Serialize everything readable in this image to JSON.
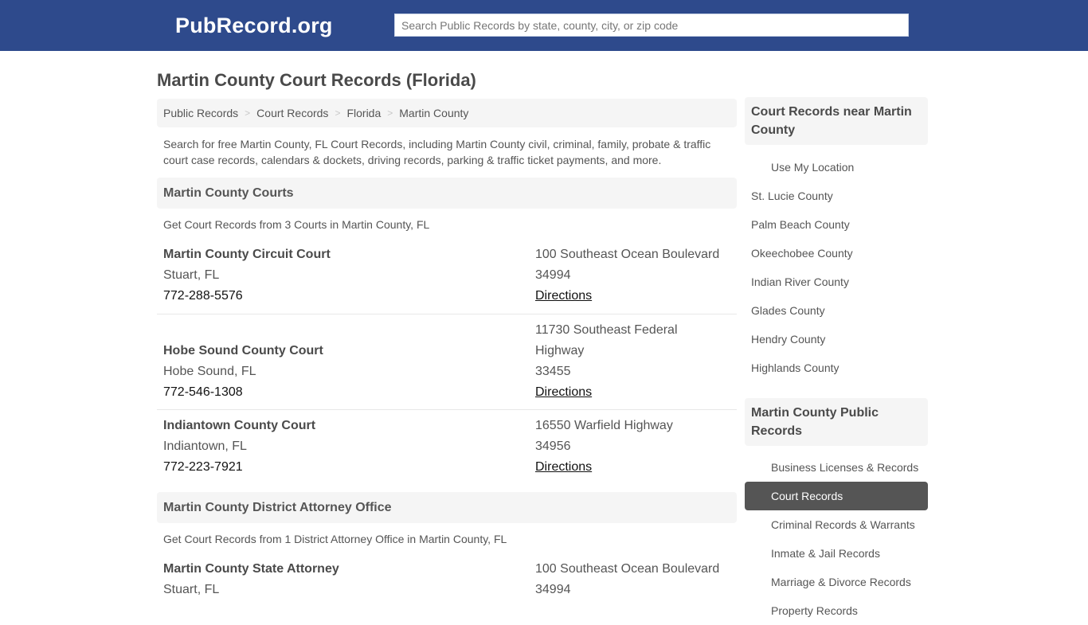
{
  "header": {
    "brand": "PubRecord.org",
    "search_placeholder": "Search Public Records by state, county, city, or zip code",
    "background_color": "#2e4a8c"
  },
  "page_title": "Martin County Court Records (Florida)",
  "breadcrumb": [
    {
      "label": "Public Records"
    },
    {
      "label": "Court Records"
    },
    {
      "label": "Florida"
    },
    {
      "label": "Martin County"
    }
  ],
  "breadcrumb_separator": ">",
  "intro": "Search for free Martin County, FL Court Records, including Martin County civil, criminal, family, probate & traffic court case records, calendars & dockets, driving records, parking & traffic ticket payments, and more.",
  "sections": [
    {
      "title": "Martin County Courts",
      "subtitle": "Get Court Records from 3 Courts in Martin County, FL",
      "entries": [
        {
          "name": "Martin County Circuit Court",
          "city": "Stuart, FL",
          "phone": "772-288-5576",
          "address_lines": [
            "100 Southeast Ocean Boulevard"
          ],
          "zip": "34994",
          "link": "Directions"
        },
        {
          "name": "Hobe Sound County Court",
          "city": "Hobe Sound, FL",
          "phone": "772-546-1308",
          "address_lines": [
            "11730 Southeast Federal",
            "Highway"
          ],
          "zip": "33455",
          "link": "Directions"
        },
        {
          "name": "Indiantown County Court",
          "city": "Indiantown, FL",
          "phone": "772-223-7921",
          "address_lines": [
            "16550 Warfield Highway"
          ],
          "zip": "34956",
          "link": "Directions"
        }
      ]
    },
    {
      "title": "Martin County District Attorney Office",
      "subtitle": "Get Court Records from 1 District Attorney Office in Martin County, FL",
      "entries": [
        {
          "name": "Martin County State Attorney",
          "city": "Stuart, FL",
          "address_lines": [
            "100 Southeast Ocean Boulevard"
          ],
          "zip": "34994"
        }
      ]
    }
  ],
  "sidebar": {
    "nearby": {
      "title": "Court Records near Martin County",
      "use_location": "Use My Location",
      "items": [
        "St. Lucie County",
        "Palm Beach County",
        "Okeechobee County",
        "Indian River County",
        "Glades County",
        "Hendry County",
        "Highlands County"
      ]
    },
    "public_records": {
      "title": "Martin County Public Records",
      "items": [
        {
          "label": "Business Licenses & Records",
          "active": false
        },
        {
          "label": "Court Records",
          "active": true
        },
        {
          "label": "Criminal Records & Warrants",
          "active": false
        },
        {
          "label": "Inmate & Jail Records",
          "active": false
        },
        {
          "label": "Marriage & Divorce Records",
          "active": false
        },
        {
          "label": "Property Records",
          "active": false
        }
      ]
    }
  }
}
